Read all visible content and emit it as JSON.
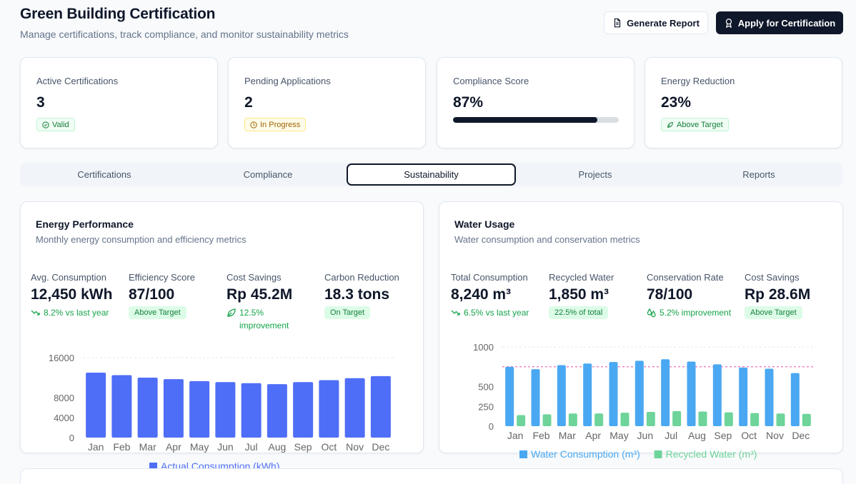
{
  "header": {
    "title": "Green Building Certification",
    "subtitle": "Manage certifications, track compliance, and monitor sustainability metrics",
    "generate_report": "Generate Report",
    "apply": "Apply for Certification"
  },
  "stats": [
    {
      "label": "Active Certifications",
      "value": "3",
      "badge": "Valid"
    },
    {
      "label": "Pending Applications",
      "value": "2",
      "badge": "In Progress"
    },
    {
      "label": "Compliance Score",
      "value": "87%",
      "progress": 0.87
    },
    {
      "label": "Energy Reduction",
      "value": "23%",
      "badge": "Above Target"
    }
  ],
  "tabs": [
    "Certifications",
    "Compliance",
    "Sustainability",
    "Projects",
    "Reports"
  ],
  "active_tab": "Sustainability",
  "energy": {
    "title": "Energy Performance",
    "subtitle": "Monthly energy consumption and efficiency metrics",
    "metrics": [
      {
        "label": "Avg. Consumption",
        "value": "12,450 kWh",
        "trend": "8.2% vs last year"
      },
      {
        "label": "Efficiency Score",
        "value": "87/100",
        "pill": "Above Target"
      },
      {
        "label": "Cost Savings",
        "value": "Rp 45.2M",
        "trend": "12.5% improvement"
      },
      {
        "label": "Carbon Reduction",
        "value": "18.3 tons",
        "pill": "On Target"
      }
    ]
  },
  "water": {
    "title": "Water Usage",
    "subtitle": "Water consumption and conservation metrics",
    "metrics": [
      {
        "label": "Total Consumption",
        "value": "8,240 m³",
        "trend": "6.5% vs last year"
      },
      {
        "label": "Recycled Water",
        "value": "1,850 m³",
        "pill": "22.5% of total"
      },
      {
        "label": "Conservation Rate",
        "value": "78/100",
        "trend": "5.2% improvement"
      },
      {
        "label": "Cost Savings",
        "value": "Rp 28.6M",
        "pill": "Above Target"
      }
    ]
  },
  "colors": {
    "accent_blue": "#4f6ef7",
    "water_blue": "#4aa8f2",
    "recycled_green": "#6ed49a",
    "target_line": "#f472b6"
  },
  "chart_data": [
    {
      "type": "bar",
      "categories": [
        "Jan",
        "Feb",
        "Mar",
        "Apr",
        "May",
        "Jun",
        "Jul",
        "Aug",
        "Sep",
        "Oct",
        "Nov",
        "Dec"
      ],
      "series": [
        {
          "name": "Actual Consumption (kWh)",
          "values": [
            13000,
            12500,
            12000,
            11700,
            11300,
            11100,
            10900,
            10700,
            11100,
            11500,
            11900,
            12300
          ]
        }
      ],
      "yticks": [
        "0",
        "4000",
        "8000",
        "16000"
      ],
      "ylim": [
        0,
        16000
      ],
      "legend": "bottom"
    },
    {
      "type": "bar",
      "categories": [
        "Jan",
        "Feb",
        "Mar",
        "Apr",
        "May",
        "Jun",
        "Jul",
        "Aug",
        "Sep",
        "Oct",
        "Nov",
        "Dec"
      ],
      "series": [
        {
          "name": "Water Consumption (m³)",
          "values": [
            750,
            720,
            770,
            790,
            810,
            825,
            845,
            815,
            780,
            740,
            725,
            670
          ]
        },
        {
          "name": "Recycled Water (m³)",
          "values": [
            140,
            150,
            160,
            160,
            170,
            180,
            190,
            185,
            175,
            165,
            160,
            155
          ]
        }
      ],
      "yticks": [
        "0",
        "250",
        "500",
        "1000"
      ],
      "ylim": [
        0,
        1000
      ],
      "target": 750,
      "legend": "bottom"
    }
  ]
}
